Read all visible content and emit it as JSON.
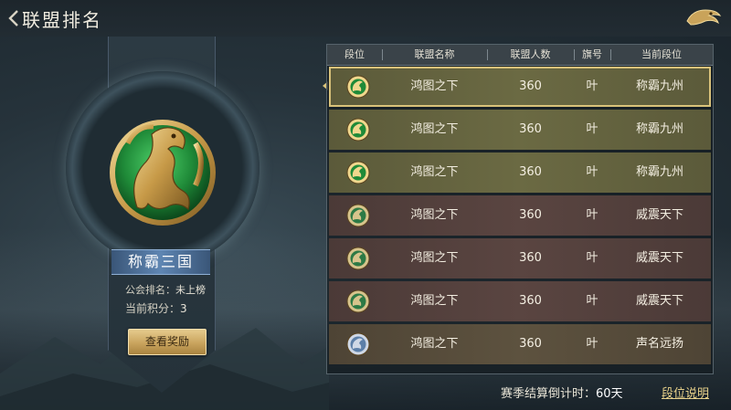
{
  "header": {
    "title": "联盟排名"
  },
  "left_panel": {
    "rank_title": "称霸三国",
    "guild_rank_label": "公会排名：",
    "guild_rank_value": "未上榜",
    "score_label": "当前积分：",
    "score_value": "3",
    "reward_button": "查看奖励"
  },
  "table": {
    "columns": [
      "段位",
      "联盟名称",
      "联盟人数",
      "旗号",
      "当前段位"
    ],
    "rows": [
      {
        "badge": "gold-dragon-badge-icon",
        "name": "鸿图之下",
        "members": "360",
        "flag": "叶",
        "tier": "称霸九州",
        "style": "olive"
      },
      {
        "badge": "gold-dragon-badge-icon",
        "name": "鸿图之下",
        "members": "360",
        "flag": "叶",
        "tier": "称霸九州",
        "style": "olive"
      },
      {
        "badge": "gold-dragon-badge-icon",
        "name": "鸿图之下",
        "members": "360",
        "flag": "叶",
        "tier": "称霸九州",
        "style": "olive"
      },
      {
        "badge": "silver-dragon-badge-icon",
        "name": "鸿图之下",
        "members": "360",
        "flag": "叶",
        "tier": "威震天下",
        "style": "maroon"
      },
      {
        "badge": "silver-dragon-badge-icon",
        "name": "鸿图之下",
        "members": "360",
        "flag": "叶",
        "tier": "威震天下",
        "style": "maroon"
      },
      {
        "badge": "silver-dragon-badge-icon",
        "name": "鸿图之下",
        "members": "360",
        "flag": "叶",
        "tier": "威震天下",
        "style": "maroon"
      },
      {
        "badge": "blue-dragon-badge-icon",
        "name": "鸿图之下",
        "members": "360",
        "flag": "叶",
        "tier": "声名远扬",
        "style": "brown"
      }
    ],
    "selected_row": 0
  },
  "footer": {
    "countdown_label": "赛季结算倒计时：",
    "countdown_value": "60天",
    "rank_help_link": "段位说明"
  },
  "colors": {
    "accent_gold": "#d9c27a",
    "row_olive": "#6b6a43",
    "row_maroon": "#5a4541",
    "row_brown": "#5d523f",
    "rank_plate_blue": "#5f86b3"
  }
}
